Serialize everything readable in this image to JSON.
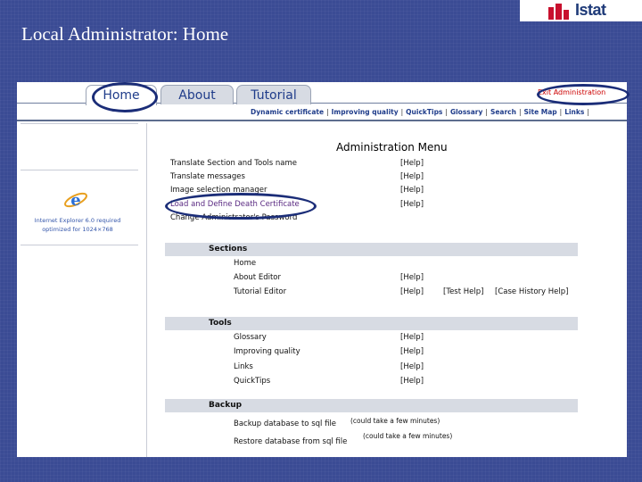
{
  "slide": {
    "title": "Local Administrator: Home"
  },
  "logo": {
    "text": "Istat"
  },
  "tabs": [
    {
      "label": "Home",
      "active": true
    },
    {
      "label": "About",
      "active": false
    },
    {
      "label": "Tutorial",
      "active": false
    }
  ],
  "exit_link": "Exit Administration",
  "topnav": [
    "Dynamic certificate",
    "Improving quality",
    "QuickTips",
    "Glossary",
    "Search",
    "Site Map",
    "Links"
  ],
  "sidebar": {
    "note_line1": "Internet Explorer 6.0 required",
    "note_line2": "optimized for 1024×768"
  },
  "menu": {
    "title": "Administration Menu",
    "items": [
      {
        "label": "Translate Section and Tools name",
        "help": "[Help]"
      },
      {
        "label": "Translate messages",
        "help": "[Help]"
      },
      {
        "label": "Image selection manager",
        "help": "[Help]"
      },
      {
        "label": "Load and Define Death Certificate",
        "help": "[Help]"
      },
      {
        "label": "Change Administrator's Password",
        "help": ""
      }
    ]
  },
  "sections": {
    "title": "Sections",
    "items": [
      {
        "label": "Home",
        "help": ""
      },
      {
        "label": "About Editor",
        "help": "[Help]"
      },
      {
        "label": "Tutorial Editor",
        "help": "[Help]",
        "extra1": "[Test Help]",
        "extra2": "[Case History Help]"
      }
    ]
  },
  "tools": {
    "title": "Tools",
    "items": [
      {
        "label": "Glossary",
        "help": "[Help]"
      },
      {
        "label": "Improving quality",
        "help": "[Help]"
      },
      {
        "label": "Links",
        "help": "[Help]"
      },
      {
        "label": "QuickTips",
        "help": "[Help]"
      }
    ]
  },
  "backup": {
    "title": "Backup",
    "items": [
      {
        "label": "Backup database to sql file",
        "note": "(could take a few minutes)"
      },
      {
        "label": "Restore database from sql file",
        "note": "(could take a few minutes)"
      }
    ]
  },
  "colors": {
    "slide_bg": "#3a4b94",
    "tab_text": "#1f3c8a",
    "exit_red": "#cc0000",
    "section_bar": "#d7dbe3",
    "circle": "#1b2d78"
  }
}
